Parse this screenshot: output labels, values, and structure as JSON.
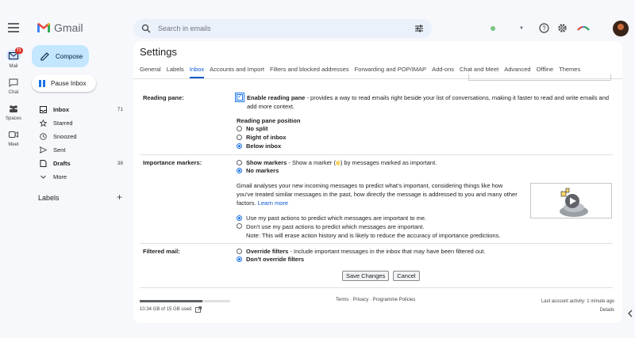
{
  "app": {
    "name": "Gmail"
  },
  "search": {
    "placeholder": "Search in emails"
  },
  "rail": [
    {
      "label": "Mail",
      "badge": "71"
    },
    {
      "label": "Chat"
    },
    {
      "label": "Spaces"
    },
    {
      "label": "Meet"
    }
  ],
  "sidebar": {
    "compose": "Compose",
    "pause": "Pause Inbox",
    "items": [
      {
        "label": "Inbox",
        "count": "71"
      },
      {
        "label": "Starred",
        "count": ""
      },
      {
        "label": "Snoozed",
        "count": ""
      },
      {
        "label": "Sent",
        "count": ""
      },
      {
        "label": "Drafts",
        "count": "38"
      },
      {
        "label": "More",
        "count": ""
      }
    ],
    "labels_heading": "Labels",
    "labels_add": "+"
  },
  "settings": {
    "title": "Settings",
    "tabs": [
      "General",
      "Labels",
      "Inbox",
      "Accounts and Import",
      "Filters and blocked addresses",
      "Forwarding and POP/IMAP",
      "Add-ons",
      "Chat and Meet",
      "Advanced",
      "Offline",
      "Themes"
    ],
    "active_tab": "Inbox",
    "reading_pane": {
      "label": "Reading pane:",
      "enable_bold": "Enable reading pane",
      "enable_rest": " - provides a way to read emails right beside your list of conversations, making it faster to read and write emails and",
      "enable_rest2": "add more context.",
      "position_heading": "Reading pane position",
      "options": [
        "No split",
        "Right of inbox",
        "Below inbox"
      ],
      "selected": "Below inbox"
    },
    "importance": {
      "label": "Importance markers:",
      "show_bold": "Show markers",
      "show_rest_a": " - Show a marker (",
      "show_rest_b": ") by messages marked as important.",
      "no_markers": "No markers",
      "para1": "Gmail analyses your new incoming messages to predict what's important, considering things like how",
      "para2": "you've treated similar messages in the past, how directly the message is addressed to you and many other",
      "para3": "factors.",
      "learn_more": "Learn more",
      "use_past": "Use my past actions to predict which messages are important to me.",
      "dont_use": "Don't use my past actions to predict which messages are important.",
      "note": "Note: This will erase action history and is likely to reduce the accuracy of importance predictions."
    },
    "filtered": {
      "label": "Filtered mail:",
      "override_bold": "Override filters",
      "override_rest": " - Include important messages in the inbox that may have been filtered out.",
      "dont_override": "Don't override filters"
    },
    "save": "Save Changes",
    "cancel": "Cancel"
  },
  "footer": {
    "storage": "10.34 GB of 15 GB used",
    "storage_fraction": 0.69,
    "terms": "Terms · Privacy · Programme Policies",
    "activity": "Last account activity: 1 minute ago",
    "details": "Details"
  },
  "colors": {
    "accent": "#0b57d0",
    "compose_bg": "#c2e7ff",
    "badge": "#d93025"
  }
}
